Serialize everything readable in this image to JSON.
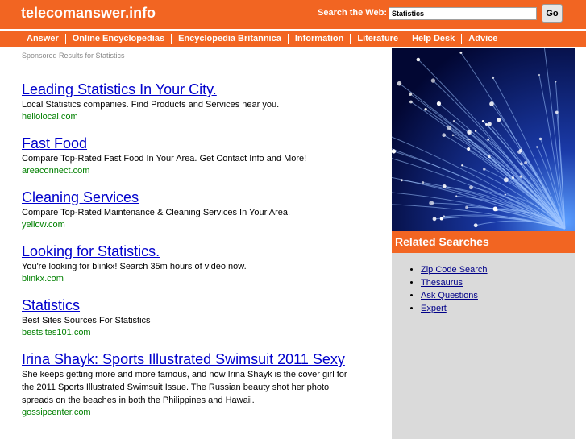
{
  "header": {
    "site_title": "telecomanswer.info",
    "search_label": "Search the Web:",
    "search_value": "Statistics",
    "go_label": "Go"
  },
  "nav": {
    "items": [
      {
        "label": "Answer"
      },
      {
        "label": "Online Encyclopedias"
      },
      {
        "label": "Encyclopedia Britannica"
      },
      {
        "label": "Information"
      },
      {
        "label": "Literature"
      },
      {
        "label": "Help Desk"
      },
      {
        "label": "Advice"
      }
    ]
  },
  "sponsored_text": "Sponsored Results for Statistics",
  "results": [
    {
      "title": "Leading Statistics In Your City.",
      "description": "Local Statistics companies. Find Products and Services near you.",
      "url": "hellolocal.com"
    },
    {
      "title": "Fast Food",
      "description": "Compare Top-Rated Fast Food In Your Area. Get Contact Info and More!",
      "url": "areaconnect.com"
    },
    {
      "title": "Cleaning Services",
      "description": "Compare Top-Rated Maintenance & Cleaning Services In Your Area.",
      "url": "yellow.com"
    },
    {
      "title": "Looking for Statistics.",
      "description": "You're looking for blinkx! Search 35m hours of video now.",
      "url": "blinkx.com"
    },
    {
      "title": "Statistics",
      "description": "Best Sites Sources For Statistics",
      "url": "bestsites101.com"
    },
    {
      "title": "Irina Shayk: Sports Illustrated Swimsuit 2011 Sexy",
      "description": "She keeps getting more and more famous, and now Irina Shayk is the cover girl for the 2011 Sports Illustrated Swimsuit Issue. The Russian beauty shot her photo spreads on the beaches in both the Philippines and Hawaii.",
      "url": "gossipcenter.com"
    }
  ],
  "sidebar": {
    "related_title": "Related Searches",
    "links": [
      {
        "label": "Zip Code Search"
      },
      {
        "label": "Thesaurus"
      },
      {
        "label": "Ask Questions"
      },
      {
        "label": "Expert"
      }
    ]
  },
  "colors": {
    "brand_orange": "#f26522",
    "link_blue": "#0000cc",
    "url_green": "#008000",
    "sidebar_gray": "#dadada"
  }
}
